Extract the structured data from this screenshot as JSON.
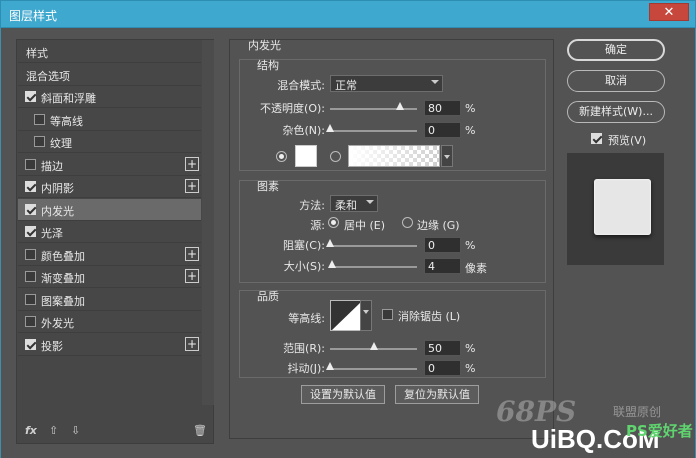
{
  "window": {
    "title": "图层样式",
    "close": "✕"
  },
  "left": {
    "items": [
      {
        "label": "样式",
        "check": null,
        "plus": false,
        "indent": 0
      },
      {
        "label": "混合选项",
        "check": null,
        "plus": false,
        "indent": 0
      },
      {
        "label": "斜面和浮雕",
        "check": true,
        "plus": false,
        "indent": 0
      },
      {
        "label": "等高线",
        "check": false,
        "plus": false,
        "indent": 1
      },
      {
        "label": "纹理",
        "check": false,
        "plus": false,
        "indent": 1
      },
      {
        "label": "描边",
        "check": false,
        "plus": true,
        "indent": 0
      },
      {
        "label": "内阴影",
        "check": true,
        "plus": true,
        "indent": 0
      },
      {
        "label": "内发光",
        "check": true,
        "plus": false,
        "indent": 0,
        "selected": true
      },
      {
        "label": "光泽",
        "check": true,
        "plus": false,
        "indent": 0
      },
      {
        "label": "颜色叠加",
        "check": false,
        "plus": true,
        "indent": 0
      },
      {
        "label": "渐变叠加",
        "check": false,
        "plus": true,
        "indent": 0
      },
      {
        "label": "图案叠加",
        "check": false,
        "plus": false,
        "indent": 0
      },
      {
        "label": "外发光",
        "check": false,
        "plus": false,
        "indent": 0
      },
      {
        "label": "投影",
        "check": true,
        "plus": true,
        "indent": 0
      }
    ],
    "footer": {
      "fx": "fx",
      "up": "⇧",
      "down": "⇩",
      "trash": "🗑"
    }
  },
  "inner_glow": {
    "title": "内发光",
    "structure": {
      "title": "结构",
      "blend_mode_label": "混合模式:",
      "blend_mode_value": "正常",
      "opacity_label": "不透明度(O):",
      "opacity_value": "80",
      "opacity_fraction": 0.8,
      "noise_label": "杂色(N):",
      "noise_value": "0",
      "noise_fraction": 0.0,
      "percent": "%"
    },
    "elements": {
      "title": "图素",
      "method_label": "方法:",
      "method_value": "柔和",
      "source_label": "源:",
      "source_center": "居中 (E)",
      "source_edge": "边缘 (G)",
      "choke_label": "阻塞(C):",
      "choke_value": "0",
      "choke_fraction": 0.0,
      "size_label": "大小(S):",
      "size_value": "4",
      "size_fraction": 0.02,
      "px_unit": "像素"
    },
    "quality": {
      "title": "品质",
      "contour_label": "等高线:",
      "antialias_label": "消除锯齿 (L)",
      "range_label": "范围(R):",
      "range_value": "50",
      "range_fraction": 0.5,
      "jitter_label": "抖动(J):",
      "jitter_value": "0",
      "jitter_fraction": 0.0
    },
    "buttons": {
      "make_default": "设置为默认值",
      "reset_default": "复位为默认值"
    }
  },
  "right": {
    "ok": "确定",
    "cancel": "取消",
    "new_style": "新建样式(W)...",
    "preview_label": "预览(V)",
    "preview_checked": true
  },
  "watermark": {
    "w1": "68PS",
    "w2": "联盟原创",
    "w3": "UiBQ.CoM",
    "w4": "PS爱好者"
  }
}
